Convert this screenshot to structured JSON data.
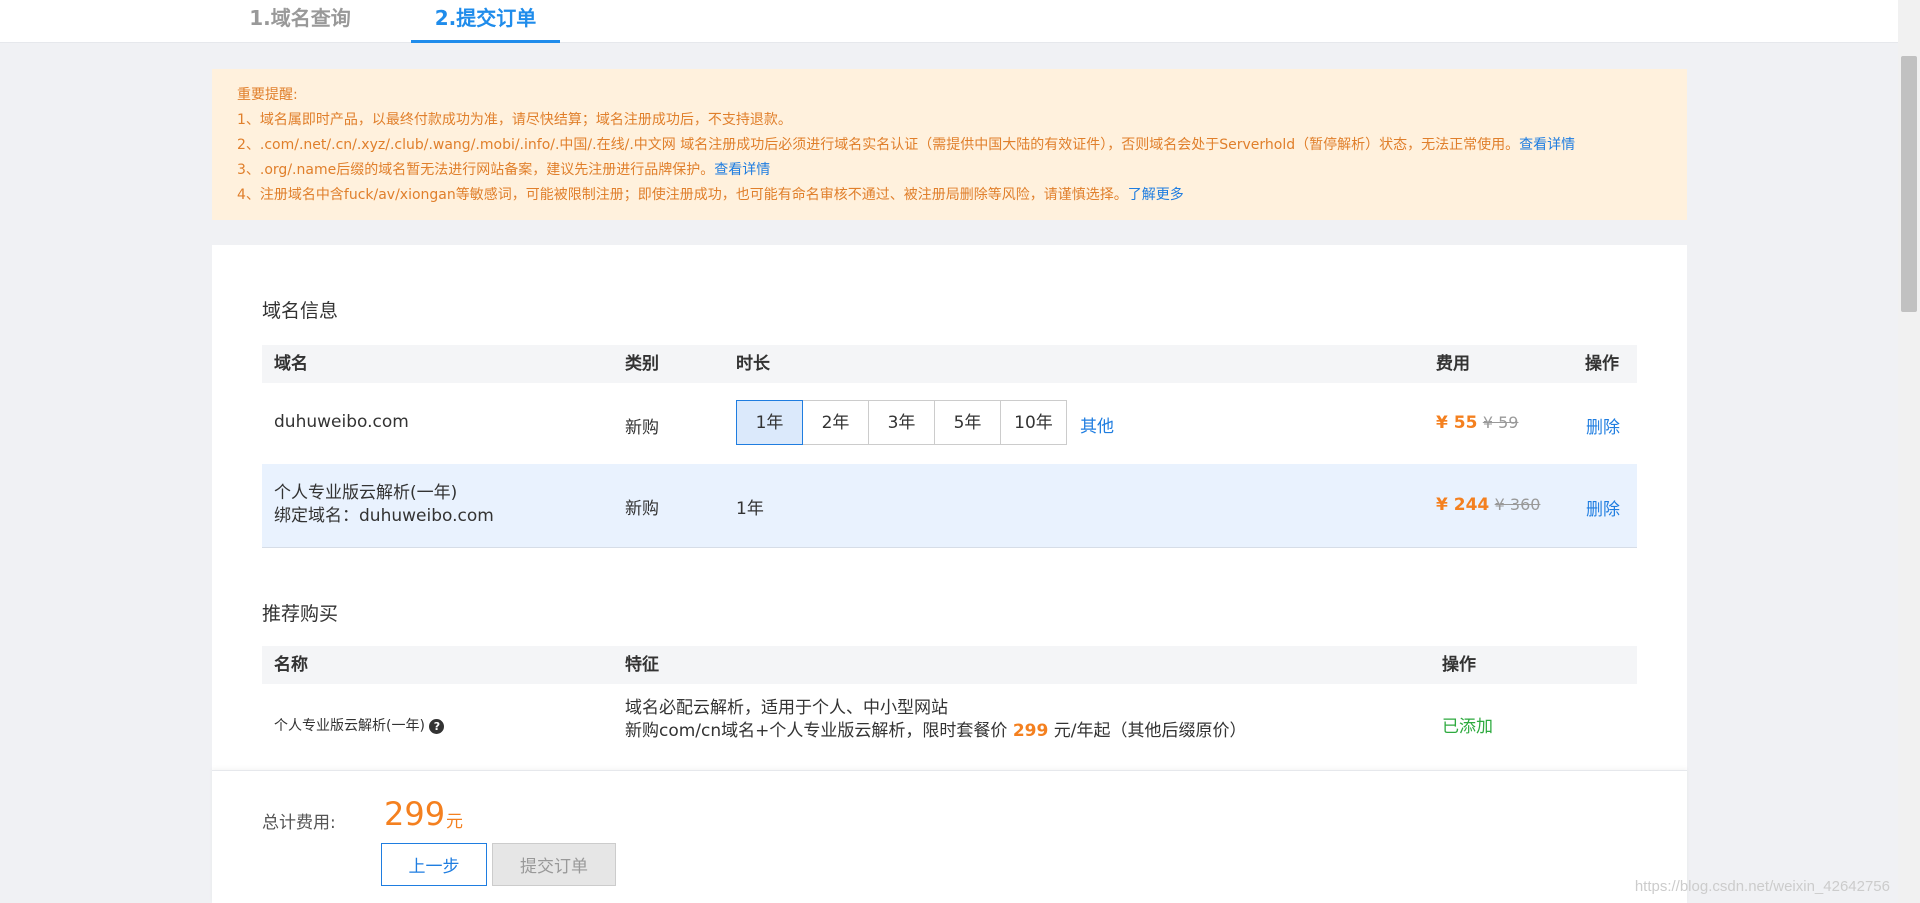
{
  "steps": [
    {
      "label": "1.域名查询"
    },
    {
      "label": "2.提交订单"
    }
  ],
  "notice": {
    "title": "重要提醒:",
    "line1": "1、域名属即时产品，以最终付款成功为准，请尽快结算；域名注册成功后，不支持退款。",
    "line2": "2、.com/.net/.cn/.xyz/.club/.wang/.mobi/.info/.中国/.在线/.中文网 域名注册成功后必须进行域名实名认证（需提供中国大陆的有效证件），否则域名会处于Serverhold（暂停解析）状态，无法正常使用。",
    "line2_link": "查看详情",
    "line3": "3、.org/.name后缀的域名暂无法进行网站备案，建议先注册进行品牌保护。",
    "line3_link": "查看详情",
    "line4": "4、注册域名中含fuck/av/xiongan等敏感词，可能被限制注册；即使注册成功，也可能有命名审核不通过、被注册局删除等风险，请谨慎选择。",
    "line4_link": "了解更多"
  },
  "domain_info": {
    "title": "域名信息",
    "headers": {
      "name": "域名",
      "type": "类别",
      "duration": "时长",
      "cost": "费用",
      "action": "操作"
    },
    "row1": {
      "name": "duhuweibo.com",
      "type": "新购",
      "durations": [
        "1年",
        "2年",
        "3年",
        "5年",
        "10年"
      ],
      "other": "其他",
      "price": "¥ 55",
      "orig_price": "¥ 59",
      "action": "删除"
    },
    "row2": {
      "name_line1": "个人专业版云解析(一年)",
      "name_line2": "绑定域名：duhuweibo.com",
      "type": "新购",
      "duration": "1年",
      "price": "¥ 244",
      "orig_price": "¥ 360",
      "action": "删除"
    }
  },
  "recommend": {
    "title": "推荐购买",
    "headers": {
      "name": "名称",
      "feature": "特征",
      "action": "操作"
    },
    "row1": {
      "name": "个人专业版云解析(一年)",
      "help": "?",
      "feature_line1": "域名必配云解析，适用于个人、中小型网站",
      "feature_line2_pre": "新购com/cn域名+个人专业版云解析，限时套餐价 ",
      "feature_price": "299",
      "feature_line2_post": " 元/年起（其他后缀原价）",
      "action": "已添加"
    }
  },
  "footer": {
    "total_label": "总计费用:",
    "total_amount": "299",
    "total_unit": "元",
    "prev": "上一步",
    "submit": "提交订单"
  },
  "watermark": "https://blog.csdn.net/weixin_42642756"
}
